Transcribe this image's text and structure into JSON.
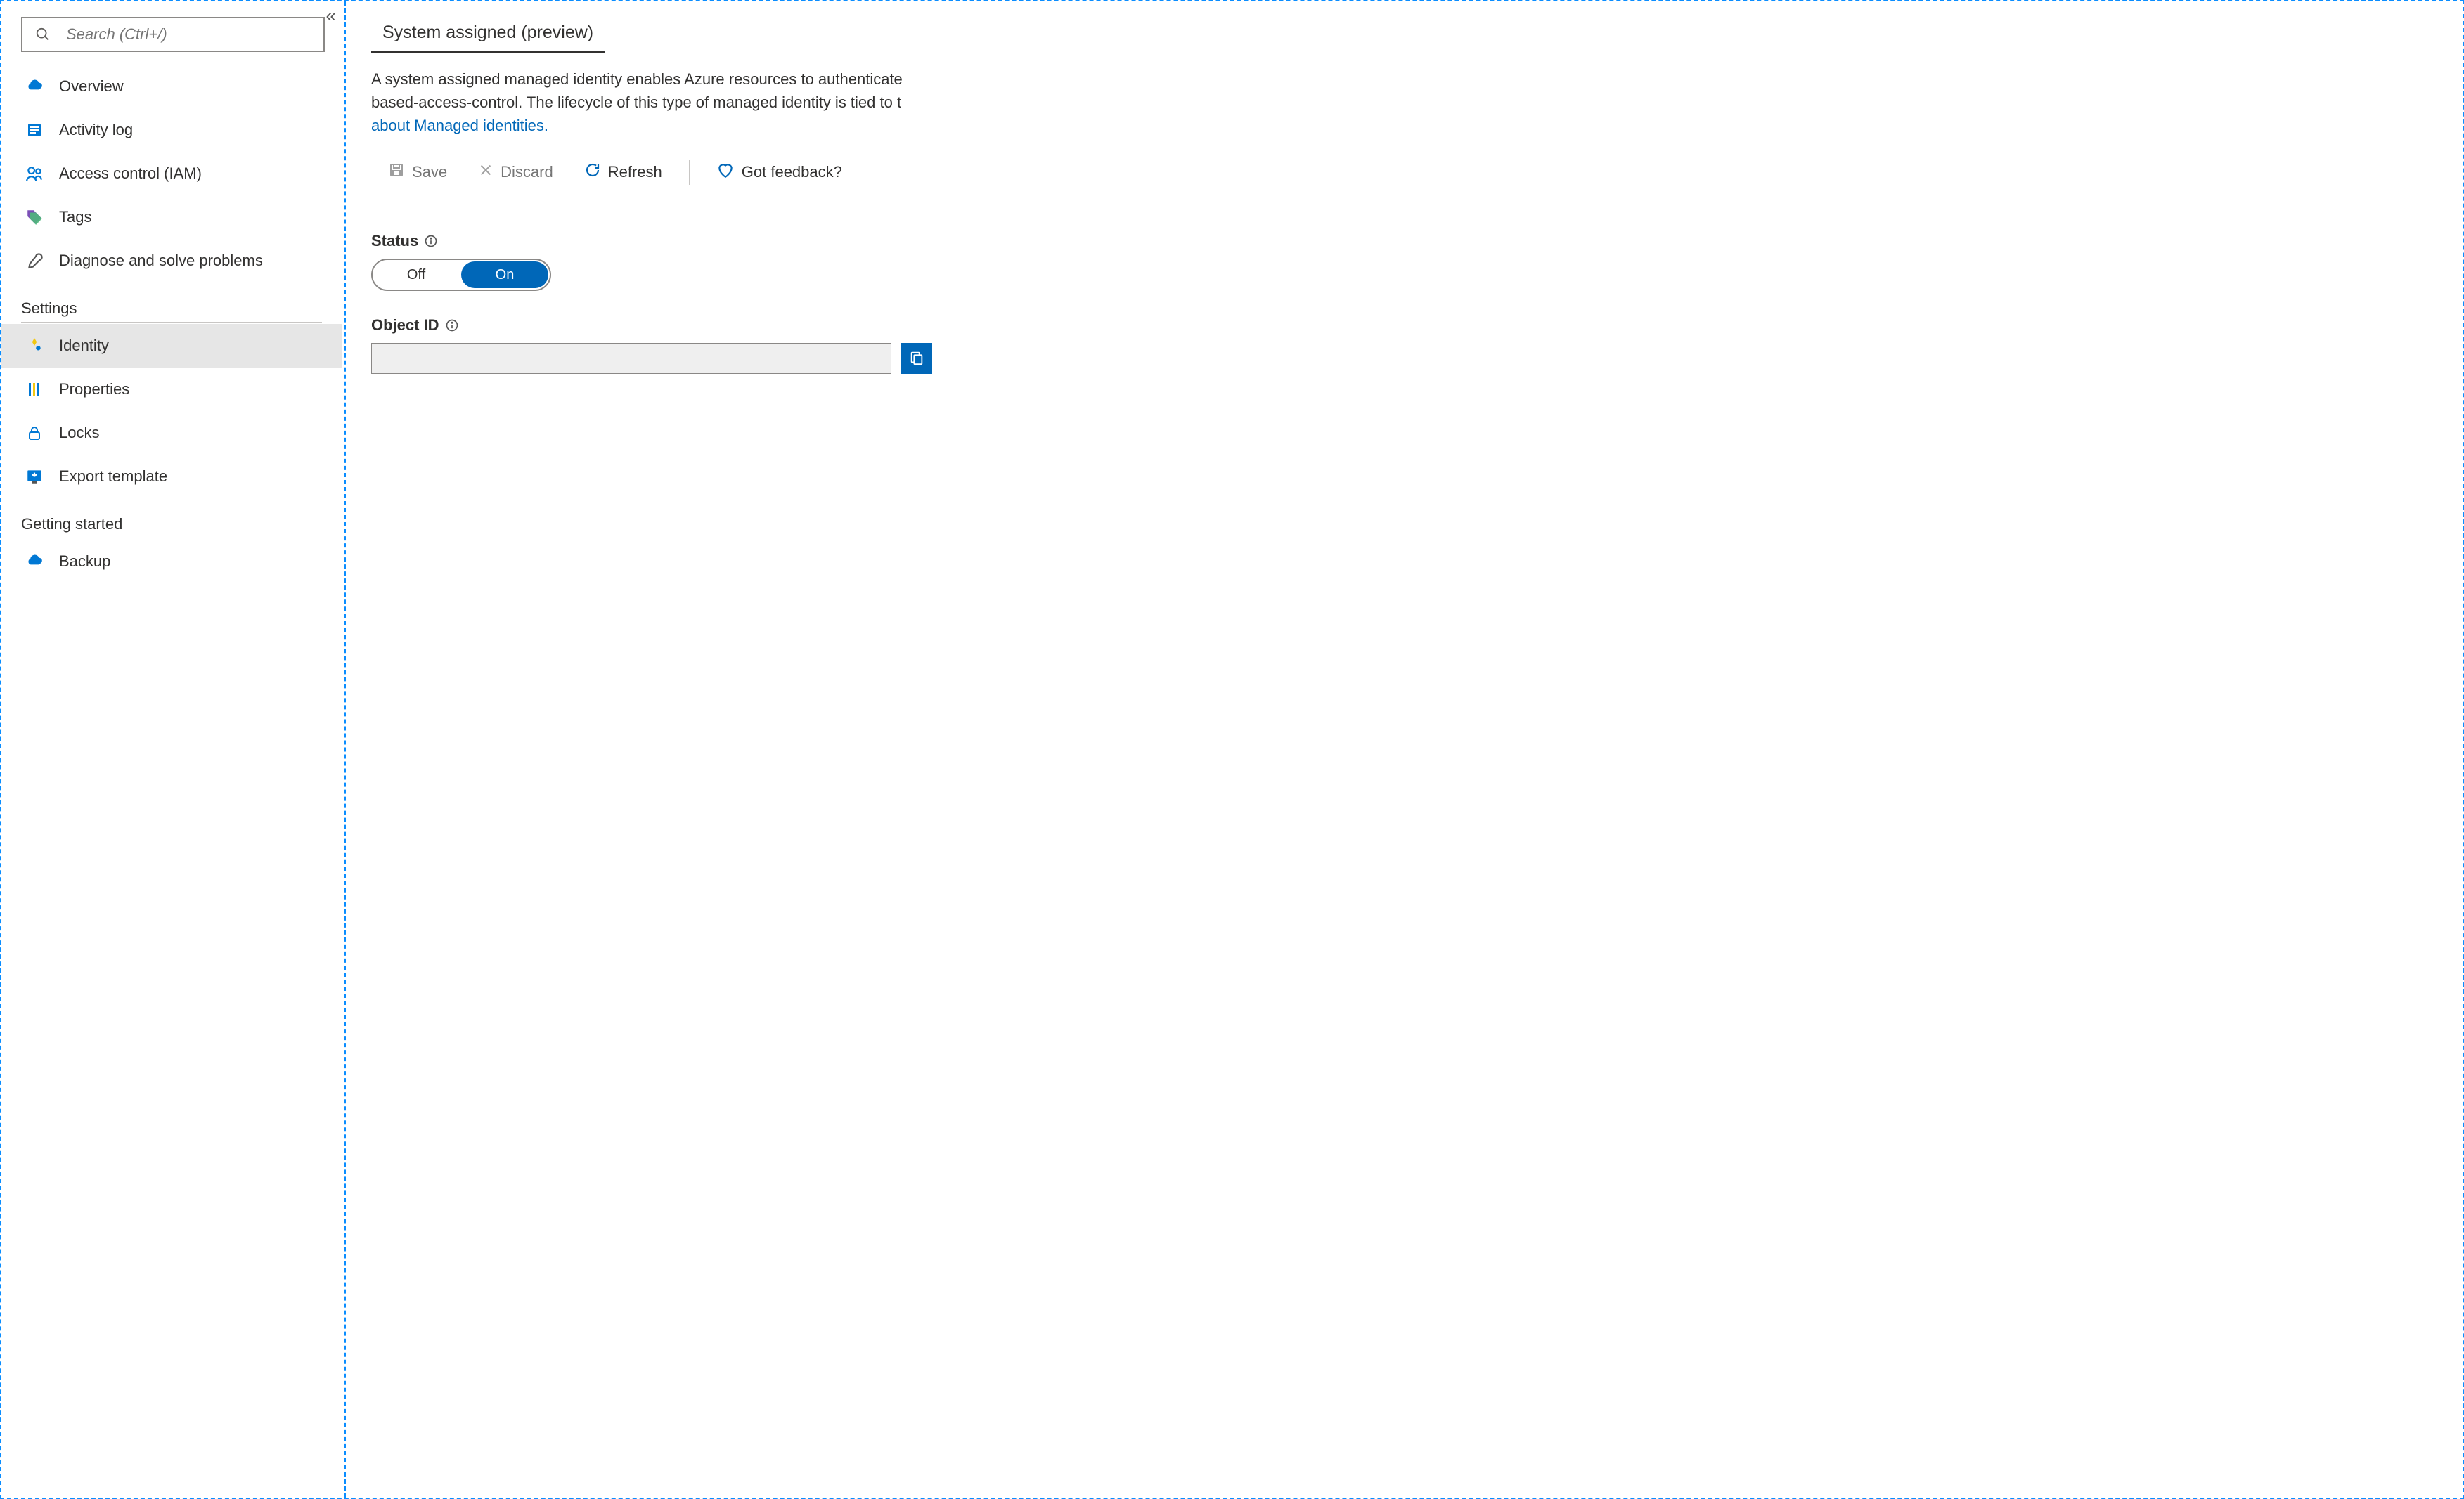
{
  "sidebar": {
    "search_placeholder": "Search (Ctrl+/)",
    "items": [
      {
        "label": "Overview",
        "icon": "cloud-overview-icon"
      },
      {
        "label": "Activity log",
        "icon": "activity-log-icon"
      },
      {
        "label": "Access control (IAM)",
        "icon": "iam-icon"
      },
      {
        "label": "Tags",
        "icon": "tags-icon"
      },
      {
        "label": "Diagnose and solve problems",
        "icon": "diagnose-icon"
      }
    ],
    "sections": [
      {
        "title": "Settings",
        "items": [
          {
            "label": "Identity",
            "icon": "identity-icon",
            "selected": true
          },
          {
            "label": "Properties",
            "icon": "properties-icon"
          },
          {
            "label": "Locks",
            "icon": "locks-icon"
          },
          {
            "label": "Export template",
            "icon": "export-template-icon"
          }
        ]
      },
      {
        "title": "Getting started",
        "items": [
          {
            "label": "Backup",
            "icon": "backup-icon"
          }
        ]
      }
    ]
  },
  "main": {
    "tab_label": "System assigned (preview)",
    "desc_part1": "A system assigned managed identity enables Azure resources to authenticate ",
    "desc_part2": "based-access-control. The lifecycle of this type of managed identity is tied to t",
    "desc_link": "about Managed identities.",
    "toolbar": {
      "save": "Save",
      "discard": "Discard",
      "refresh": "Refresh",
      "feedback": "Got feedback?"
    },
    "status_label": "Status",
    "status_off": "Off",
    "status_on": "On",
    "status_value": "On",
    "objectid_label": "Object ID",
    "objectid_value": ""
  }
}
